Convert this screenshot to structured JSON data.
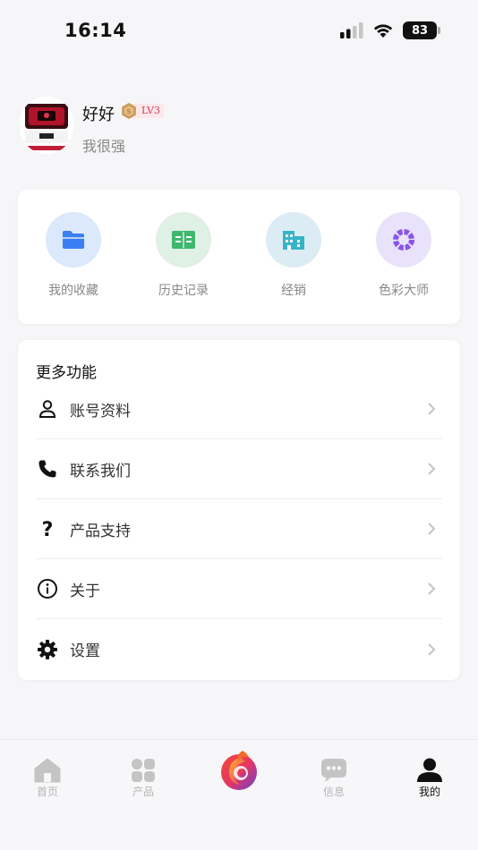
{
  "status_bar": {
    "time": "16:14",
    "battery": "83"
  },
  "profile": {
    "name": "好好",
    "level": "LV3",
    "bio": "我很强"
  },
  "quick_actions": [
    {
      "label": "我的收藏",
      "icon": "folder-icon",
      "bg": "#dce8fb",
      "color": "#3b7ef1"
    },
    {
      "label": "历史记录",
      "icon": "book-icon",
      "bg": "#dff0e4",
      "color": "#3eb86c"
    },
    {
      "label": "经销",
      "icon": "building-icon",
      "bg": "#dcecf4",
      "color": "#37b3c8"
    },
    {
      "label": "色彩大师",
      "icon": "color-ring-icon",
      "bg": "#e8e3fb",
      "color": "#8a55e8"
    }
  ],
  "more": {
    "title": "更多功能",
    "items": [
      {
        "label": "账号资料",
        "icon": "person-icon"
      },
      {
        "label": "联系我们",
        "icon": "phone-icon"
      },
      {
        "label": "产品支持",
        "icon": "question-icon"
      },
      {
        "label": "关于",
        "icon": "info-icon"
      },
      {
        "label": "设置",
        "icon": "gear-icon"
      }
    ]
  },
  "tabbar": {
    "items": [
      {
        "label": "首页",
        "icon": "home-icon",
        "active": false
      },
      {
        "label": "产品",
        "icon": "grid-icon",
        "active": false
      },
      {
        "label": "",
        "icon": "brand-logo-icon",
        "active": false
      },
      {
        "label": "信息",
        "icon": "chat-icon",
        "active": false
      },
      {
        "label": "我的",
        "icon": "user-icon",
        "active": true
      }
    ]
  },
  "colors": {
    "accent_inactive": "#b6b6b6",
    "level_badge_bg": "#fde7ea",
    "level_badge_text": "#d04060"
  }
}
